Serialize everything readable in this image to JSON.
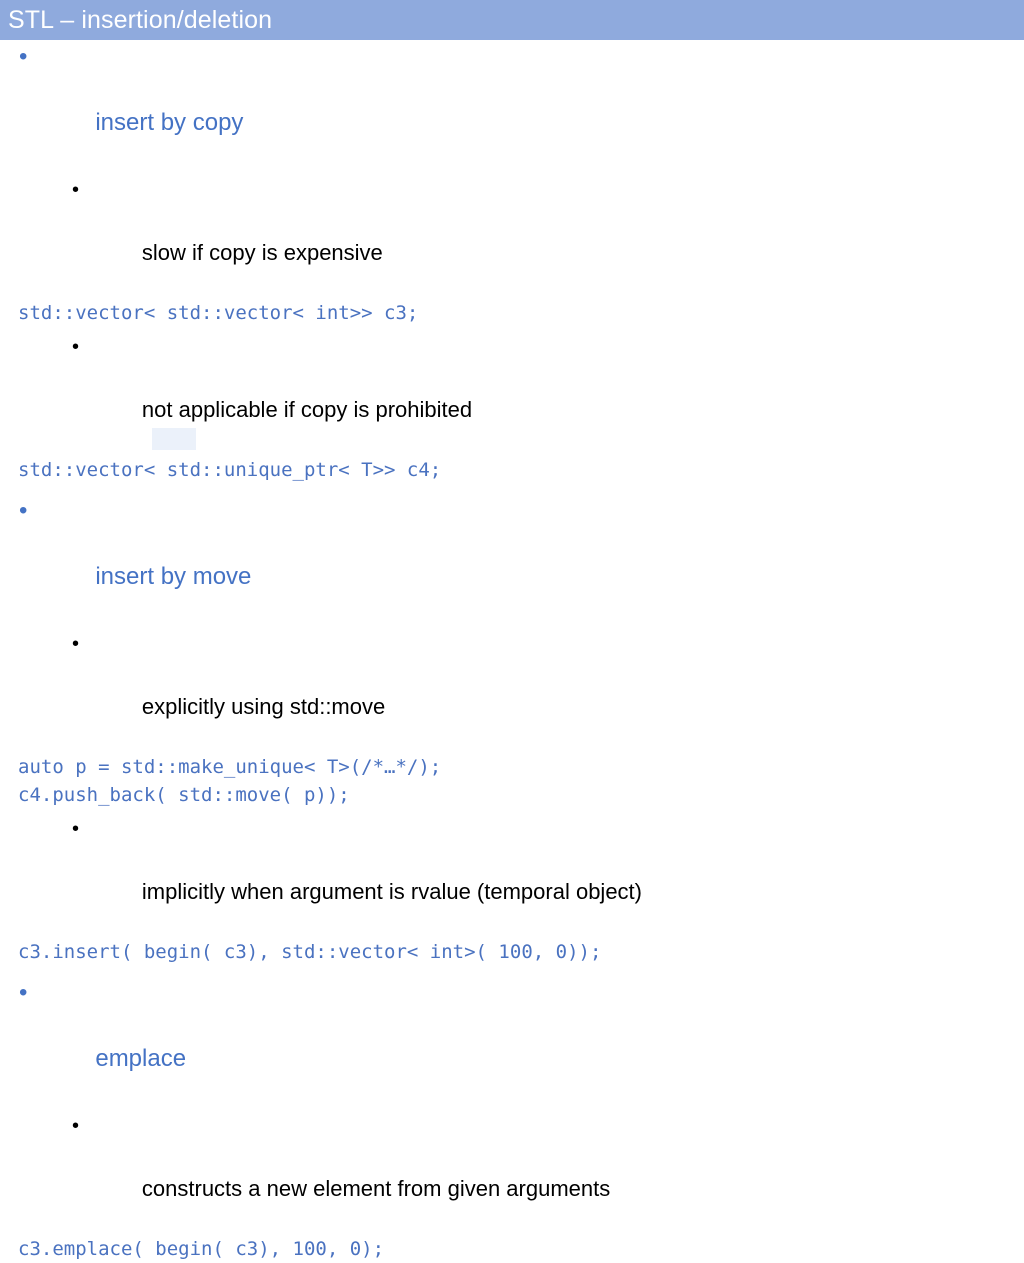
{
  "slide": {
    "title": "STL – insertion/deletion",
    "title_bar_color": "#8FAADD",
    "heading_color": "#4472C4",
    "code_color": "#4A72C0",
    "body_color": "#000000",
    "background_color": "#FFFFFF",
    "bullet_glyph": "•",
    "blocks": [
      {
        "heading": "insert by copy",
        "items": [
          {
            "text": "slow if copy is expensive",
            "code": [
              "std::vector< std::vector< int>> c3;"
            ]
          },
          {
            "text": "not applicable if copy is prohibited",
            "code": [
              "std::vector< std::unique_ptr< T>> c4;"
            ]
          }
        ]
      },
      {
        "heading": "insert by move",
        "items": [
          {
            "text": "explicitly using std::move",
            "code": [
              "auto p = std::make_unique< T>(/*…*/);",
              "c4.push_back( std::move( p));"
            ]
          },
          {
            "text": "implicitly when argument is rvalue (temporal object)",
            "code": [
              "c3.insert( begin( c3), std::vector< int>( 100, 0));"
            ]
          }
        ]
      },
      {
        "heading": "emplace",
        "items": [
          {
            "text": "constructs a new element from given arguments",
            "code": [
              "c3.emplace( begin( c3), 100, 0);"
            ]
          }
        ]
      }
    ]
  }
}
